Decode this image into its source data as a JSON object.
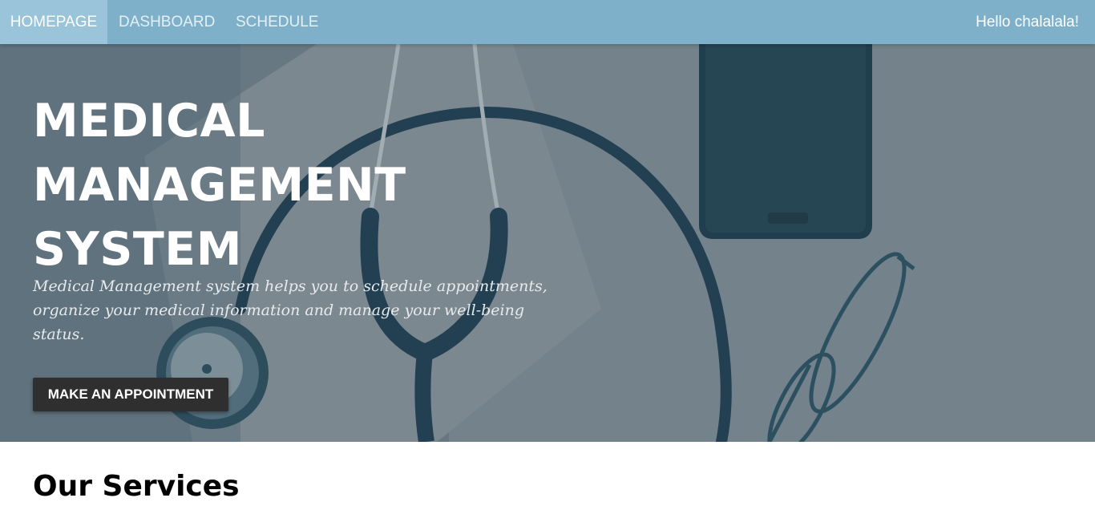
{
  "nav": {
    "items": [
      {
        "label": "HOMEPAGE",
        "active": true
      },
      {
        "label": "DASHBOARD",
        "active": false
      },
      {
        "label": "SCHEDULE",
        "active": false
      }
    ],
    "greeting": "Hello chalalala!"
  },
  "hero": {
    "title_lines": [
      "MEDICAL",
      "MANAGEMENT",
      "SYSTEM"
    ],
    "description": "Medical Management system helps you to schedule appointments, organize your medical information and manage your well-being status.",
    "cta_label": "MAKE AN APPOINTMENT"
  },
  "services": {
    "title": "Our Services"
  },
  "colors": {
    "navbar": "#7fb0ca",
    "nav_active": "#99c4da",
    "button": "#2f2f2f"
  },
  "icons": {
    "hero_background": "stethoscope-phone-glasses-photo"
  }
}
